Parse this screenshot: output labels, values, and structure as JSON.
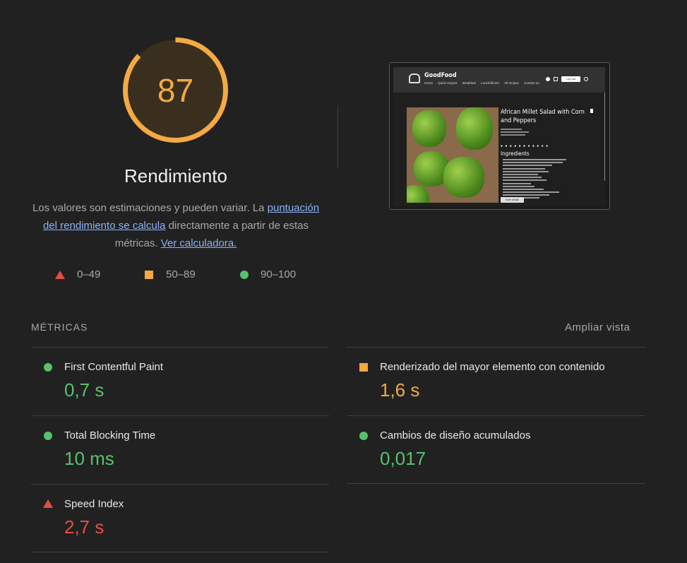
{
  "score": {
    "value": "87",
    "fraction": 0.87,
    "color": "#f4a942",
    "track_color": "#3a2f1e"
  },
  "category_title": "Rendimiento",
  "description": {
    "text_before": "Los valores son estimaciones y pueden variar. La ",
    "link1": "puntuación del rendimiento se calcula",
    "text_middle": " directamente a partir de estas métricas. ",
    "link2": "Ver calculadora."
  },
  "legend": [
    {
      "icon": "triangle-icon",
      "label": "0–49",
      "color": "#e44e41"
    },
    {
      "icon": "square-icon",
      "label": "50–89",
      "color": "#f4a942"
    },
    {
      "icon": "circle-icon",
      "label": "90–100",
      "color": "#57c16e"
    }
  ],
  "screenshot": {
    "brand": "GoodFood",
    "nav_links": [
      "Home",
      "Quick recipes",
      "Breakfast",
      "Lunch/dinner",
      "All recipes",
      "Contact us"
    ],
    "login": "Log out",
    "recipe_title": "African Millet Salad with Corn and Peppers",
    "ingredients_title": "Ingredients",
    "button": "More details"
  },
  "metrics": {
    "header": "MÉTRICAS",
    "expand_label": "Ampliar vista",
    "items": [
      {
        "label": "First Contentful Paint",
        "value": "0,7 s",
        "status": "good",
        "color": "#57c16e"
      },
      {
        "label": "Renderizado del mayor elemento con contenido",
        "value": "1,6 s",
        "status": "average",
        "color": "#f4a942"
      },
      {
        "label": "Total Blocking Time",
        "value": "10 ms",
        "status": "good",
        "color": "#57c16e"
      },
      {
        "label": "Cambios de diseño acumulados",
        "value": "0,017",
        "status": "good",
        "color": "#57c16e"
      },
      {
        "label": "Speed Index",
        "value": "2,7 s",
        "status": "poor",
        "color": "#e44e41"
      }
    ]
  }
}
